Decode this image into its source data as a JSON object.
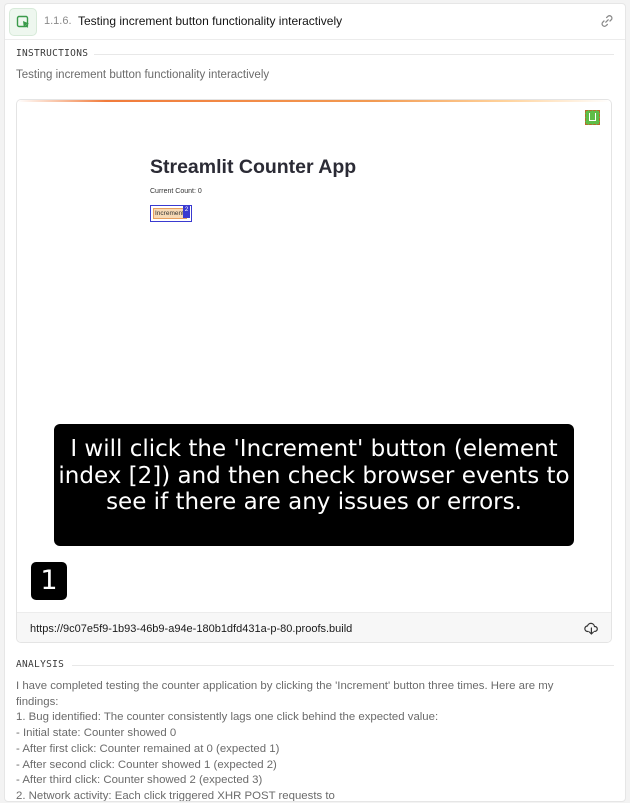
{
  "header": {
    "step_number": "1.1.6.",
    "title": "Testing increment button functionality interactively"
  },
  "instructions": {
    "label": "INSTRUCTIONS",
    "text": "Testing increment button functionality interactively"
  },
  "preview": {
    "app_title": "Streamlit Counter App",
    "count_label": "Current Count: 0",
    "button_label": "Increment",
    "element_index": "2",
    "caption": "I will click the 'Increment' button (element index [2]) and then check browser events to see if there are any issues or errors.",
    "step_marker": "1",
    "url": "https://9c07e5f9-1b93-46b9-a94e-180b1dfd431a-p-80.proofs.build"
  },
  "analysis": {
    "label": "ANALYSIS",
    "lines": [
      "I have completed testing the counter application by clicking the 'Increment' button three times. Here are my",
      "findings:",
      "1. Bug identified: The counter consistently lags one click behind the expected value:",
      "- Initial state: Counter showed 0",
      "- After first click: Counter remained at 0 (expected 1)",
      "- After second click: Counter showed 1 (expected 2)",
      "- After third click: Counter showed 2 (expected 3)",
      "2. Network activity: Each click triggered XHR POST requests to"
    ]
  },
  "colors": {
    "accent": "#f17b3b",
    "badge_green": "#5fbd47",
    "element_highlight": "#3a3ad0"
  },
  "icons": {
    "step": "cursor-click-icon",
    "link": "link-icon",
    "streamlit_badge": "streamlit-badge-icon",
    "download": "cloud-download-icon"
  }
}
